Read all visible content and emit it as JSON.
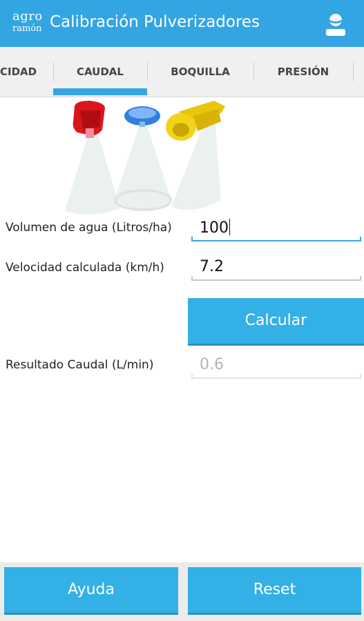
{
  "app": {
    "logo_line1": "agro",
    "logo_line2": "ramón",
    "title": "Calibración Pulverizadores",
    "accent_color": "#33a5e2",
    "user_icon": "user-icon"
  },
  "tabs": [
    {
      "label": "CIDAD",
      "selected": false
    },
    {
      "label": "CAUDAL",
      "selected": true
    },
    {
      "label": "BOQUILLA",
      "selected": false
    },
    {
      "label": "PRESIÓN",
      "selected": false
    }
  ],
  "form": {
    "volumen_label": "Volumen de agua (Litros/ha)",
    "volumen_value": "100",
    "velocidad_label": "Velocidad calculada (km/h)",
    "velocidad_value": "7.2",
    "calcular_label": "Calcular",
    "resultado_label": "Resultado Caudal (L/min)",
    "resultado_value": "0.6"
  },
  "bottom": {
    "ayuda_label": "Ayuda",
    "reset_label": "Reset"
  },
  "illustration": {
    "icon": "spray-nozzles-illustration",
    "nozzle_colors": [
      "#d8161b",
      "#2f7fe0",
      "#e8c60a"
    ]
  }
}
